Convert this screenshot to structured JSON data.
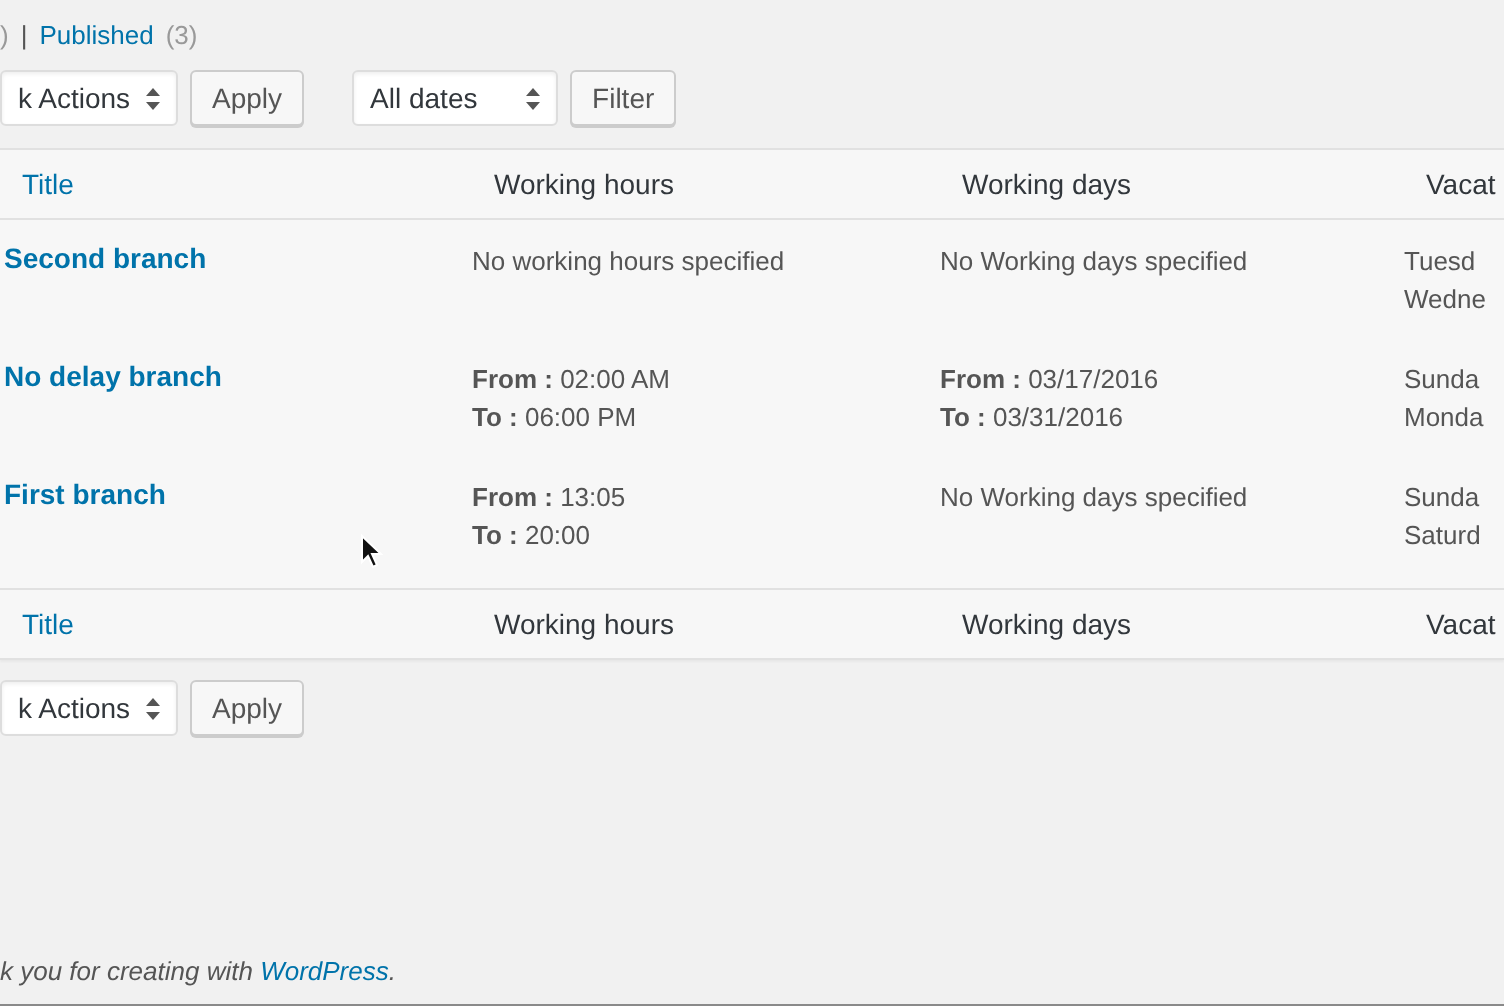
{
  "status_links": {
    "before": ")",
    "separator": "|",
    "published": {
      "label": "Published",
      "count": "(3)"
    }
  },
  "top_toolbar": {
    "bulk_actions": "k Actions",
    "apply": "Apply",
    "dates": "All dates",
    "filter": "Filter"
  },
  "table": {
    "columns": [
      "Title",
      "Working hours",
      "Working days",
      "Vacat"
    ],
    "rows": [
      {
        "title": "Second branch",
        "working_hours": [
          "No working hours specified"
        ],
        "working_days": [
          "No Working days specified"
        ],
        "vacation": [
          "Tuesd",
          "Wedne"
        ]
      },
      {
        "title": "No delay branch",
        "working_hours": [
          "**From :** 02:00 AM",
          "**To :** 06:00 PM"
        ],
        "working_days": [
          "**From :** 03/17/2016",
          "**To :** 03/31/2016"
        ],
        "vacation": [
          "Sunda",
          "Monda"
        ]
      },
      {
        "title": "First branch",
        "working_hours": [
          "**From :** 13:05",
          "**To :** 20:00"
        ],
        "working_days": [
          "No Working days specified"
        ],
        "vacation": [
          "Sunda",
          "Saturd"
        ]
      }
    ],
    "footer_columns": [
      "Title",
      "Working hours",
      "Working days",
      "Vacat"
    ]
  },
  "bottom_toolbar": {
    "bulk_actions": "k Actions",
    "apply": "Apply"
  },
  "footer": {
    "text": "k you for creating with",
    "link": "WordPress",
    "end": "."
  }
}
